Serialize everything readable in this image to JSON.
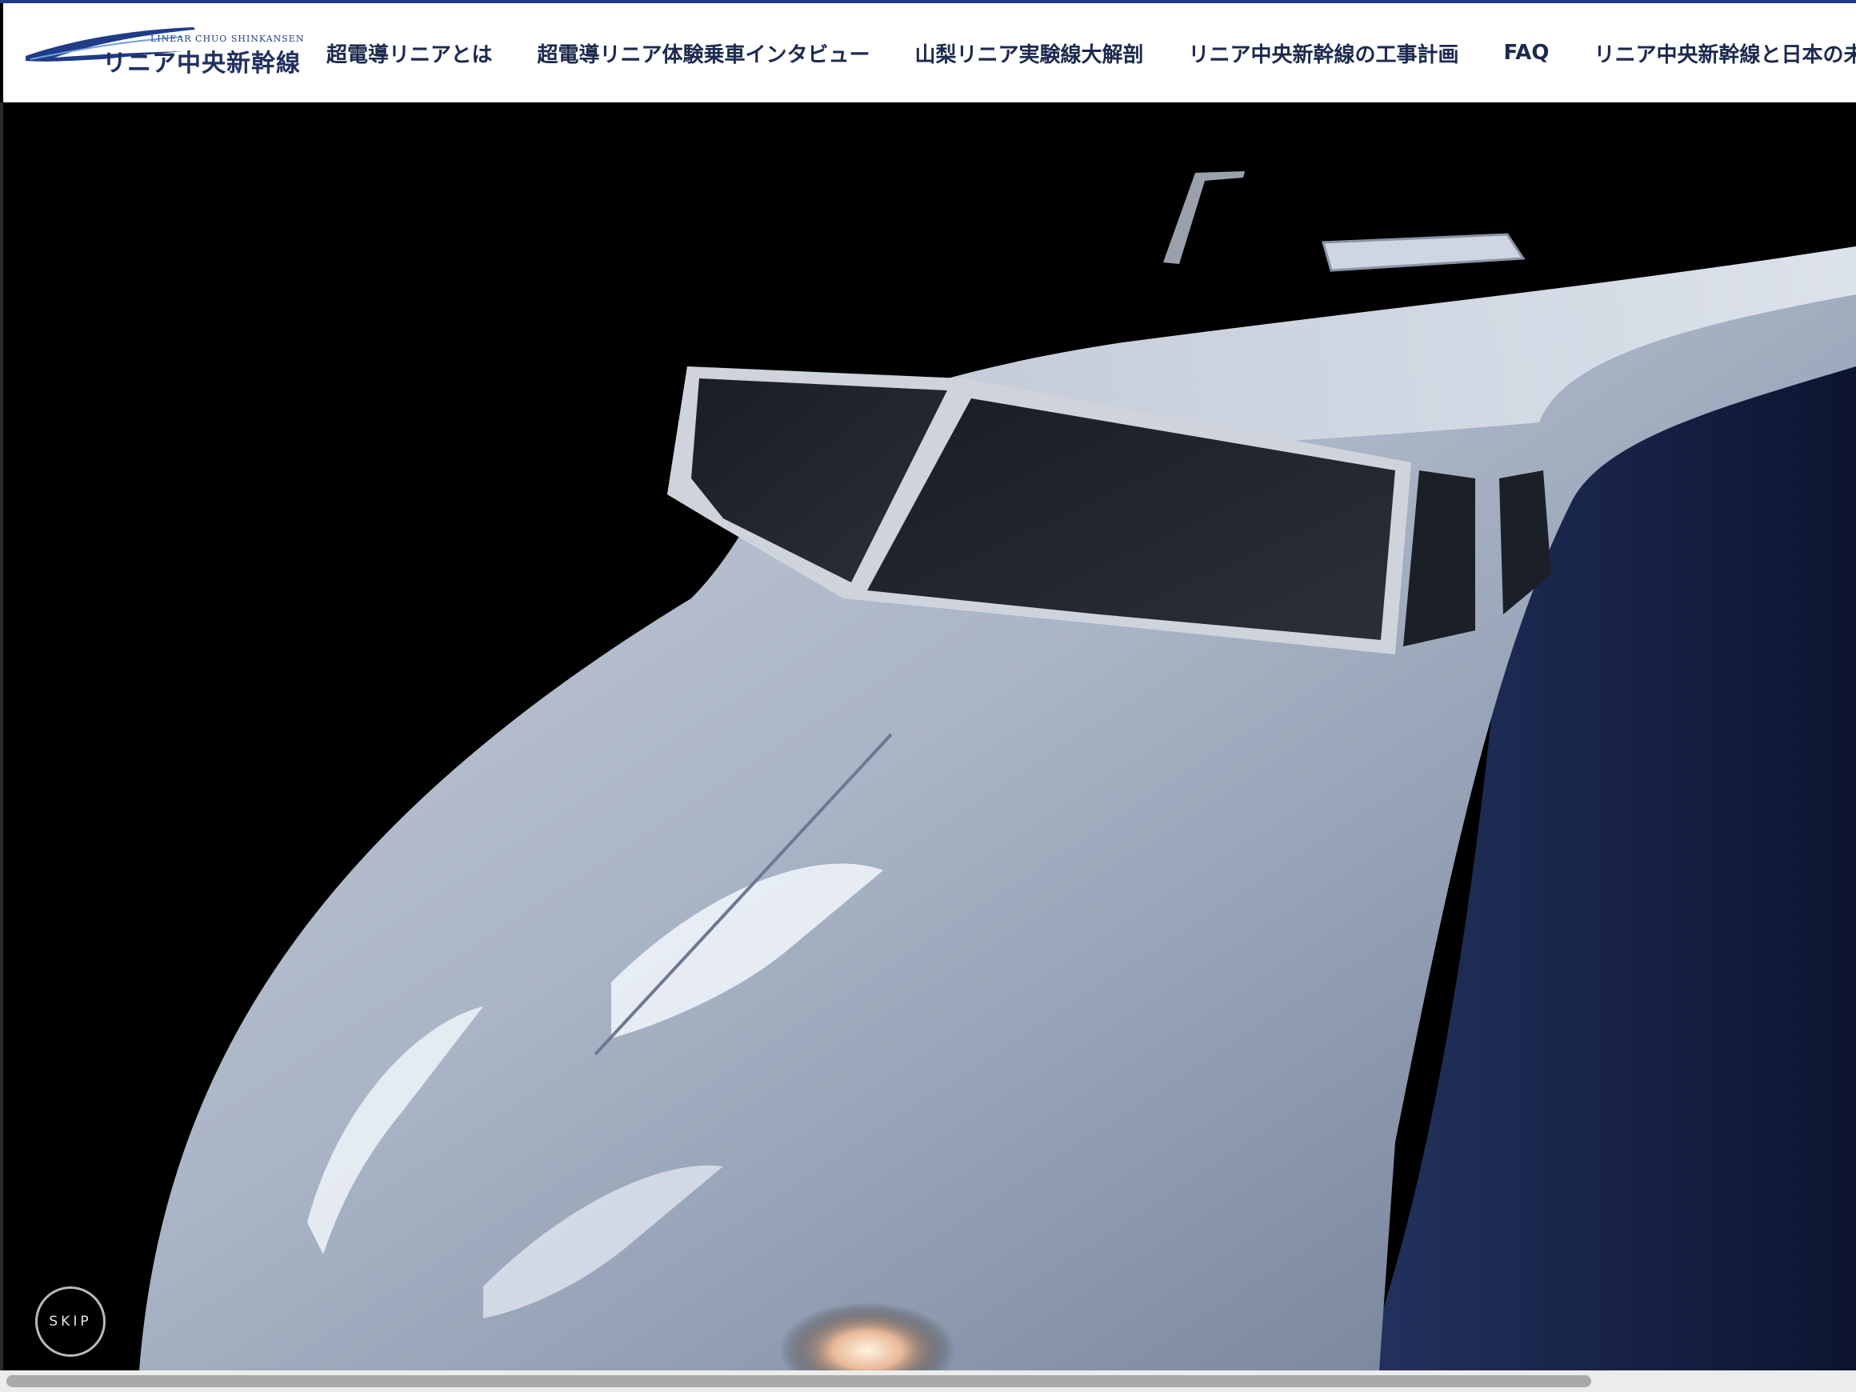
{
  "header": {
    "logo": {
      "en": "LINEAR CHUO SHINKANSEN",
      "jp": "リニア中央新幹線"
    },
    "nav": [
      {
        "label": "超電導リニアとは"
      },
      {
        "label": "超電導リニア体験乗車インタビュー"
      },
      {
        "label": "山梨リニア実験線大解剖"
      },
      {
        "label": "リニア中央新幹線の工事計画"
      },
      {
        "label": "FAQ"
      },
      {
        "label": "リニア中央新幹線と日本の未"
      }
    ]
  },
  "hero": {
    "skip_label": "SKIP"
  },
  "scrollbar": {
    "thumb_fraction": 0.86
  },
  "colors": {
    "accent": "#1f3c88",
    "nav_text": "#1c2a4e",
    "background": "#000000"
  }
}
